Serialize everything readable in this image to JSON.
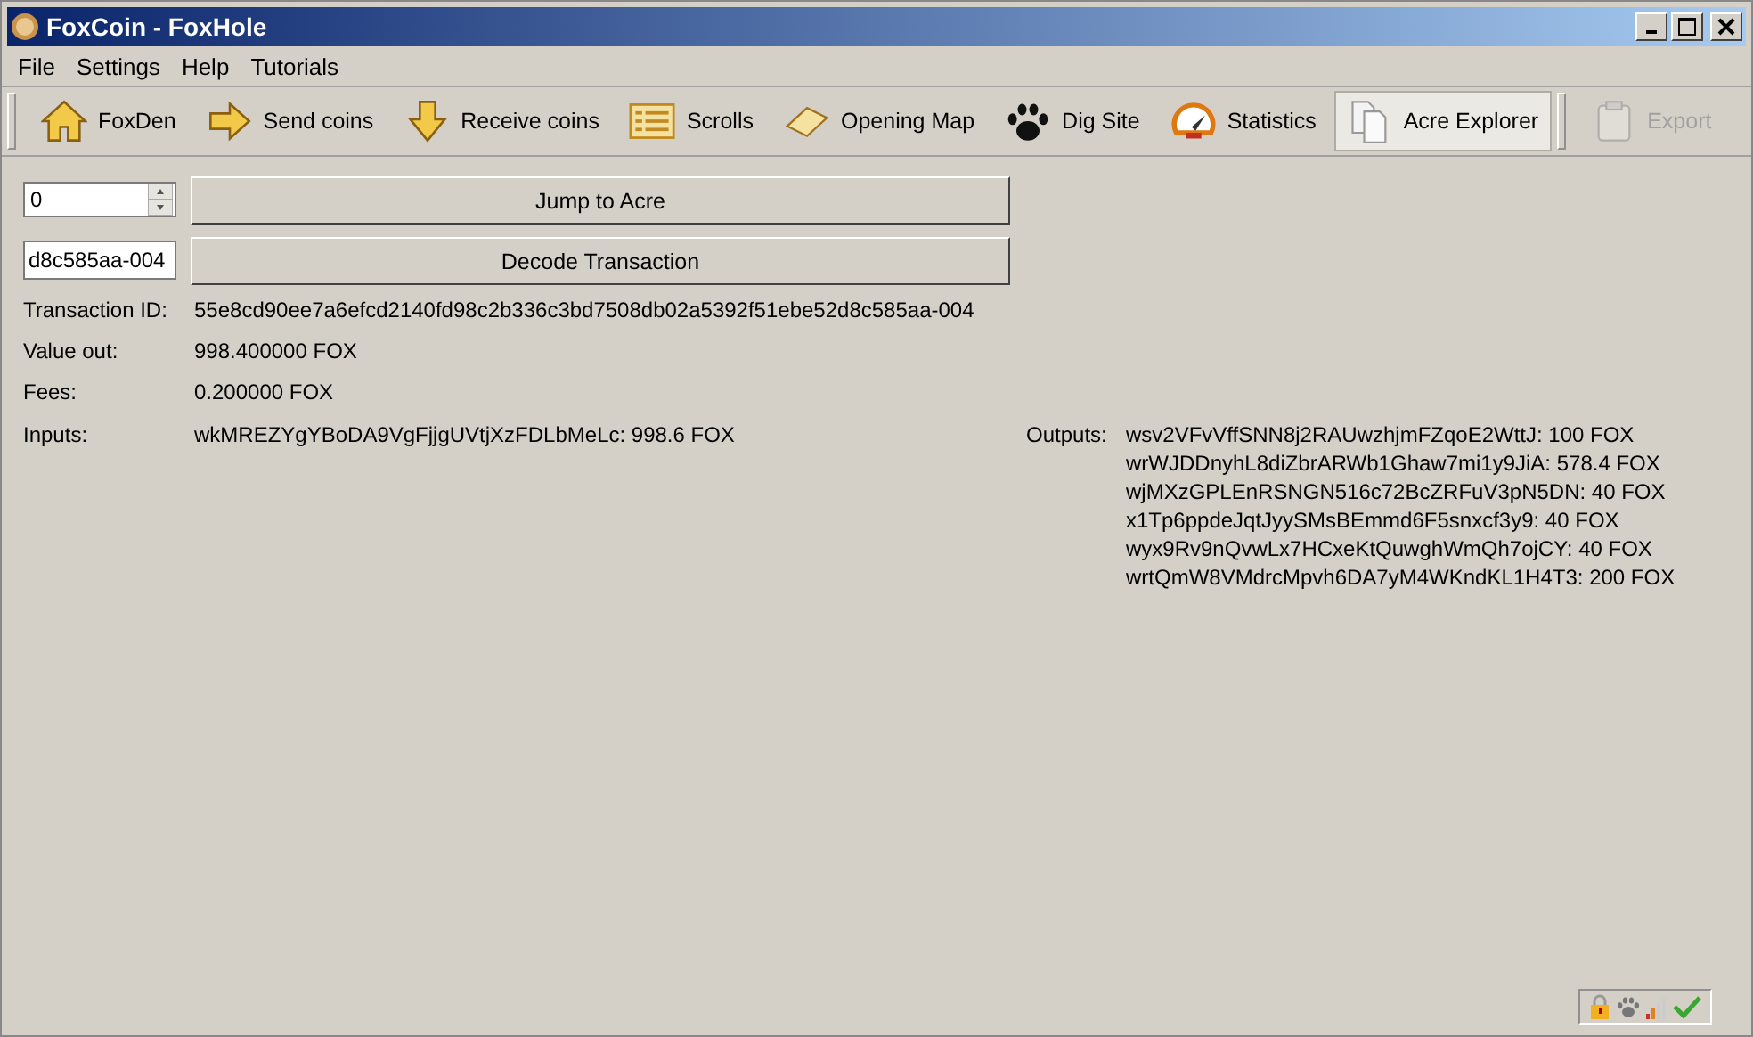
{
  "window": {
    "title": "FoxCoin - FoxHole"
  },
  "menu": [
    "File",
    "Settings",
    "Help",
    "Tutorials"
  ],
  "toolbar": [
    {
      "label": "FoxDen",
      "selected": false,
      "disabled": false
    },
    {
      "label": "Send coins",
      "selected": false,
      "disabled": false
    },
    {
      "label": "Receive coins",
      "selected": false,
      "disabled": false
    },
    {
      "label": "Scrolls",
      "selected": false,
      "disabled": false
    },
    {
      "label": "Opening Map",
      "selected": false,
      "disabled": false
    },
    {
      "label": "Dig Site",
      "selected": false,
      "disabled": false
    },
    {
      "label": "Statistics",
      "selected": false,
      "disabled": false
    },
    {
      "label": "Acre Explorer",
      "selected": true,
      "disabled": false
    }
  ],
  "toolbar_extra": [
    {
      "label": "Export",
      "selected": false,
      "disabled": true
    }
  ],
  "acre_field": {
    "value": "0"
  },
  "jump_button": "Jump to Acre",
  "tx_field": {
    "value": "d8c585aa-004"
  },
  "decode_button": "Decode Transaction",
  "details": [
    {
      "label": "Transaction ID:",
      "value": "55e8cd90ee7a6efcd2140fd98c2b336c3bd7508db02a5392f51ebe52d8c585aa-004"
    },
    {
      "label": "Value out:",
      "value": "998.400000 FOX"
    },
    {
      "label": "Fees:",
      "value": "0.200000 FOX"
    }
  ],
  "inputs": {
    "label": "Inputs:",
    "items": [
      "wkMREZYgYBoDA9VgFjjgUVtjXzFDLbMeLc: 998.6 FOX"
    ]
  },
  "outputs": {
    "label": "Outputs:",
    "items": [
      "wsv2VFvVffSNN8j2RAUwzhjmFZqoE2WttJ: 100 FOX",
      "wrWJDDnyhL8diZbrARWb1Ghaw7mi1y9JiA: 578.4 FOX",
      "wjMXzGPLEnRSNGN516c72BcZRFuV3pN5DN: 40 FOX",
      "x1Tp6ppdeJqtJyySMsBEmmd6F5snxcf3y9: 40 FOX",
      "wyx9Rv9nQvwLx7HCxeKtQuwghWmQh7ojCY: 40 FOX",
      "wrtQmW8VMdrcMpvh6DA7yM4WKndKL1H4T3: 200 FOX"
    ]
  }
}
